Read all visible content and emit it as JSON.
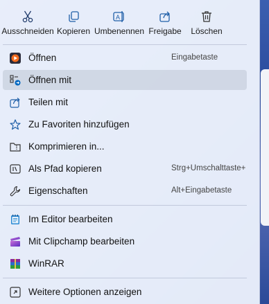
{
  "toolbar": {
    "cut": "Ausschneiden",
    "copy": "Kopieren",
    "rename": "Umbenennen",
    "share": "Freigabe",
    "delete": "Löschen"
  },
  "items": [
    {
      "label": "Öffnen",
      "shortcut": "Eingabetaste",
      "icon": "media-player-icon"
    },
    {
      "label": "Öffnen mit",
      "shortcut": "",
      "icon": "open-with-icon"
    },
    {
      "label": "Teilen mit",
      "shortcut": "",
      "icon": "share-icon"
    },
    {
      "label": "Zu Favoriten hinzufügen",
      "shortcut": "",
      "icon": "star-icon"
    },
    {
      "label": "Komprimieren in...",
      "shortcut": "",
      "icon": "zip-folder-icon"
    },
    {
      "label": "Als Pfad kopieren",
      "shortcut": "Strg+Umschalttaste+",
      "icon": "copy-path-icon"
    },
    {
      "label": "Eigenschaften",
      "shortcut": "Alt+Eingabetaste",
      "icon": "wrench-icon"
    },
    {
      "label": "Im Editor bearbeiten",
      "shortcut": "",
      "icon": "notepad-icon"
    },
    {
      "label": "Mit Clipchamp bearbeiten",
      "shortcut": "",
      "icon": "clipchamp-icon"
    },
    {
      "label": "WinRAR",
      "shortcut": "",
      "icon": "winrar-icon"
    },
    {
      "label": "Weitere Optionen anzeigen",
      "shortcut": "",
      "icon": "more-options-icon"
    }
  ],
  "colors": {
    "accent": "#0067c0",
    "hover": "#c8d0de"
  }
}
